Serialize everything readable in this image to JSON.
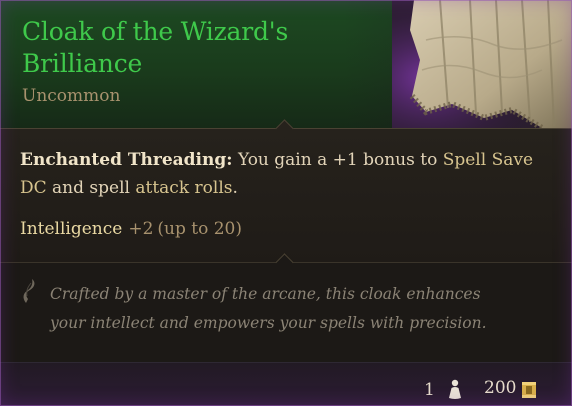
{
  "item": {
    "name": "Cloak of the Wizard's Brilliance",
    "rarity": "Uncommon"
  },
  "effect": {
    "name": "Enchanted Threading:",
    "text_before": " You gain a +1 bonus to ",
    "keyword_1": "Spell Save DC",
    "text_middle": " and spell ",
    "keyword_2": "attack rolls",
    "text_after": "."
  },
  "stat": {
    "name": "Intelligence",
    "bonus": "+2",
    "cap": "(up to 20)"
  },
  "flavour": {
    "text": "Crafted by a master of the arcane, this cloak enhances your intellect and empowers your spells with precision."
  },
  "footer": {
    "weight": "1",
    "value": "200",
    "weight_icon": "weight-icon",
    "gold_icon": "gold-coin-icon"
  },
  "colors": {
    "title": "#3fc94b",
    "rarity": "#a8926e",
    "header_bg": "#1d4a22",
    "frame_glow": "#9a5ab4"
  }
}
